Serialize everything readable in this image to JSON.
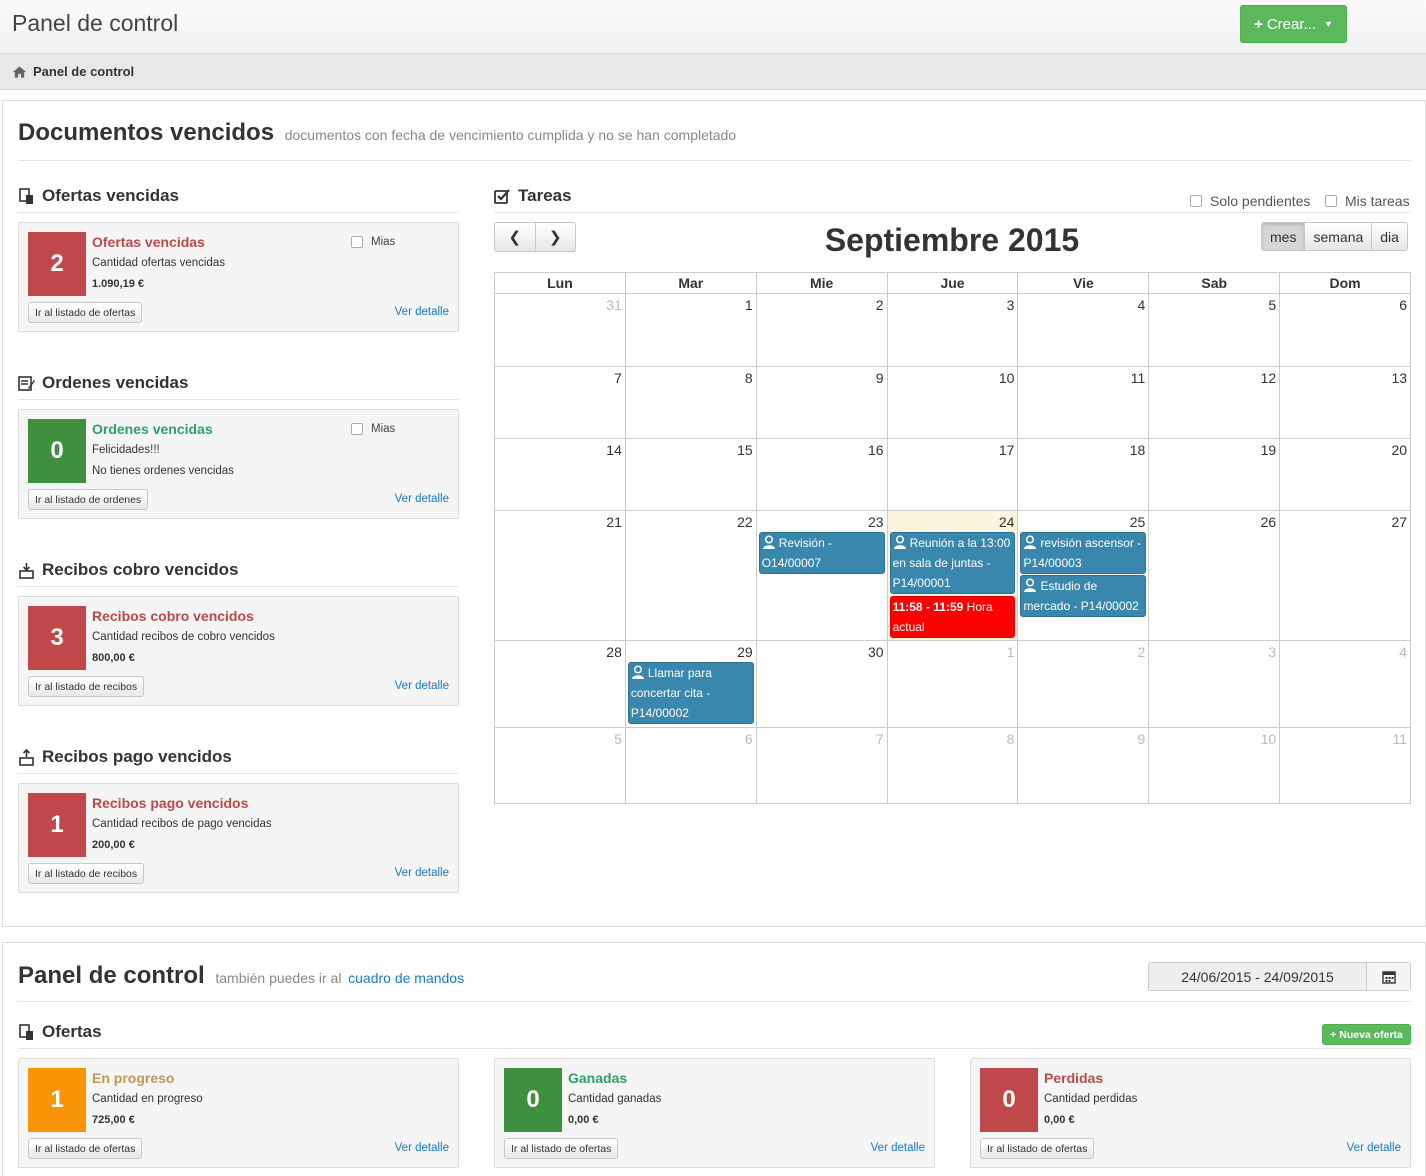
{
  "topbar": {
    "title": "Panel de control",
    "create_label": "Crear..."
  },
  "breadcrumb": {
    "label": "Panel de control"
  },
  "overdue": {
    "title": "Documentos vencidos",
    "subtitle": "documentos con fecha de vencimiento cumplida y no se han completado",
    "sections": [
      {
        "heading": "Ofertas vencidas",
        "count": "2",
        "title": "Ofertas vencidas",
        "desc": "Cantidad ofertas vencidas",
        "amount": "1.090,19 €",
        "mias": "Mias",
        "button": "Ir al listado de ofertas",
        "link": "Ver detalle"
      },
      {
        "heading": "Ordenes vencidas",
        "count": "0",
        "title": "Ordenes vencidas",
        "desc": "Felicidades!!!",
        "amount": "No tienes ordenes vencidas",
        "mias": "Mias",
        "button": "Ir al listado de ordenes",
        "link": "Ver detalle"
      },
      {
        "heading": "Recibos cobro vencidos",
        "count": "3",
        "title": "Recibos cobro vencidos",
        "desc": "Cantidad recibos de cobro vencidos",
        "amount": "800,00 €",
        "button": "Ir al listado de recibos",
        "link": "Ver detalle"
      },
      {
        "heading": "Recibos pago vencidos",
        "count": "1",
        "title": "Recibos pago vencidos",
        "desc": "Cantidad recibos de pago vencidas",
        "amount": "200,00 €",
        "button": "Ir al listado de recibos",
        "link": "Ver detalle"
      }
    ]
  },
  "tasks": {
    "heading": "Tareas",
    "only_pending": "Solo pendientes",
    "my_tasks": "Mis tareas",
    "calendar_title": "Septiembre 2015",
    "views": [
      "mes",
      "semana",
      "dia"
    ],
    "active_view": "mes",
    "weekdays": [
      "Lun",
      "Mar",
      "Mie",
      "Jue",
      "Vie",
      "Sab",
      "Dom"
    ],
    "weeks": [
      [
        "31",
        "1",
        "2",
        "3",
        "4",
        "5",
        "6"
      ],
      [
        "7",
        "8",
        "9",
        "10",
        "11",
        "12",
        "13"
      ],
      [
        "14",
        "15",
        "16",
        "17",
        "18",
        "19",
        "20"
      ],
      [
        "21",
        "22",
        "23",
        "24",
        "25",
        "26",
        "27"
      ],
      [
        "28",
        "29",
        "30",
        "1",
        "2",
        "3",
        "4"
      ],
      [
        "5",
        "6",
        "7",
        "8",
        "9",
        "10",
        "11"
      ]
    ],
    "events": {
      "ev1": "Revisión - O14/00007",
      "ev2": "Reunión a la 13:00 en sala de juntas - P14/00001",
      "ev3_time": "11:58 - 11:59",
      "ev3_label": "Hora actual",
      "ev4": "revisión ascensor - P14/00003",
      "ev5": "Estudio de mercado - P14/00002",
      "ev6": "Llamar para concertar cita - P14/00002"
    },
    "event_color": "#3a87ad",
    "now_color": "#ff0000"
  },
  "dashboard": {
    "title": "Panel de control",
    "subtitle": "también puedes ir al",
    "link": "cuadro de mandos",
    "date_range": "24/06/2015 - 24/09/2015",
    "offers_heading": "Ofertas",
    "new_offer": "Nueva oferta",
    "cards": [
      {
        "count": "1",
        "title": "En progreso",
        "desc": "Cantidad en progreso",
        "amount": "725,00 €",
        "button": "Ir al listado de ofertas",
        "link": "Ver detalle"
      },
      {
        "count": "0",
        "title": "Ganadas",
        "desc": "Cantidad ganadas",
        "amount": "0,00 €",
        "button": "Ir al listado de ofertas",
        "link": "Ver detalle"
      },
      {
        "count": "0",
        "title": "Perdidas",
        "desc": "Cantidad perdidas",
        "amount": "0,00 €",
        "button": "Ir al listado de ofertas",
        "link": "Ver detalle"
      }
    ]
  }
}
